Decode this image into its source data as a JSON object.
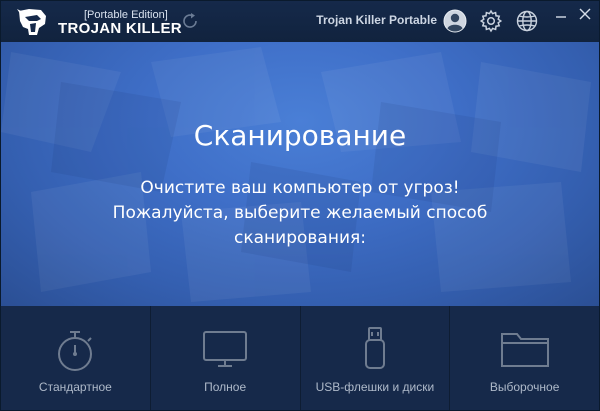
{
  "titlebar": {
    "edition": "[Portable Edition]",
    "app_name": "TROJAN KILLER",
    "product_label": "Trojan Killer Portable"
  },
  "hero": {
    "title": "Сканирование",
    "subtitle_line1": "Очистите ваш компьютер от угроз!",
    "subtitle_line2": "Пожалуйста, выберите желаемый способ",
    "subtitle_line3": "сканирования:"
  },
  "options": [
    {
      "label": "Стандартное",
      "icon": "stopwatch-icon"
    },
    {
      "label": "Полное",
      "icon": "monitor-icon"
    },
    {
      "label": "USB-флешки и диски",
      "icon": "usb-drive-icon"
    },
    {
      "label": "Выборочное",
      "icon": "folder-icon"
    }
  ],
  "colors": {
    "titlebar_bg": "#13274a",
    "hero_blue": "#3f6fc8",
    "options_bg": "#16294a",
    "icon_gray": "#6f7c90"
  }
}
